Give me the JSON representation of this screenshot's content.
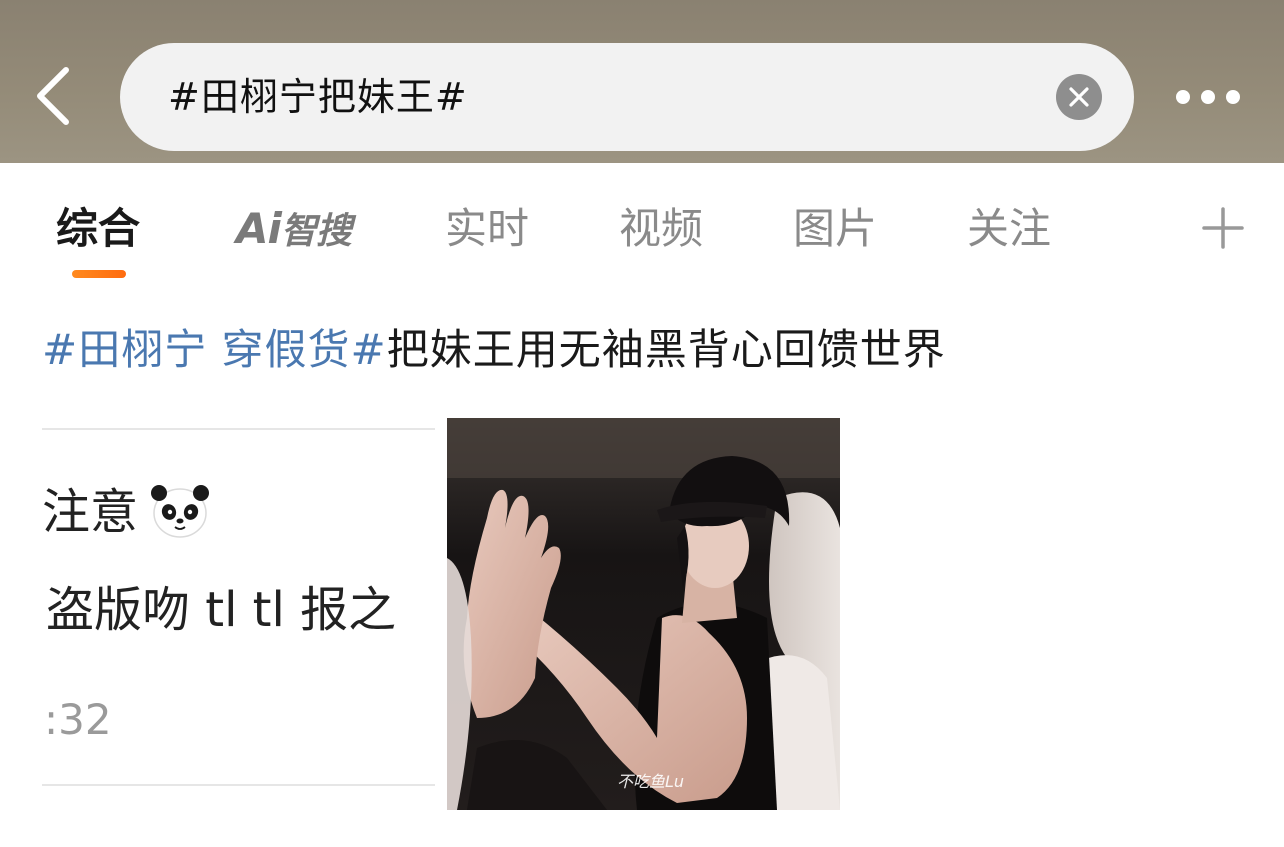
{
  "search": {
    "query": "#田栩宁把妹王#"
  },
  "icons": {
    "back": "chevron-left-icon",
    "clear": "close-circle-icon",
    "more": "more-dots-icon",
    "add": "plus-icon",
    "emoji": "panda-emoji-icon"
  },
  "tabs": [
    {
      "label": "综合",
      "active": true
    },
    {
      "label": "Ai智搜",
      "active": false
    },
    {
      "label": "实时",
      "active": false
    },
    {
      "label": "视频",
      "active": false
    },
    {
      "label": "图片",
      "active": false
    },
    {
      "label": "关注",
      "active": false
    }
  ],
  "ai_tab": {
    "prefix": "Ai",
    "suffix": "智搜"
  },
  "headline": {
    "topic": "#田栩宁 穿假货#",
    "text": "把妹王用无袖黑背心回馈世界"
  },
  "left_card": {
    "line1": "注意",
    "line2": "盗版吻 tl tl 报之",
    "line3": ":32"
  },
  "photo": {
    "watermark": "不吃鱼Lu"
  },
  "colors": {
    "topic_blue": "#4a78b0",
    "tab_indicator": "#ff7a14",
    "header_bg": "#8f8674",
    "search_bg": "#f2f2f2"
  }
}
